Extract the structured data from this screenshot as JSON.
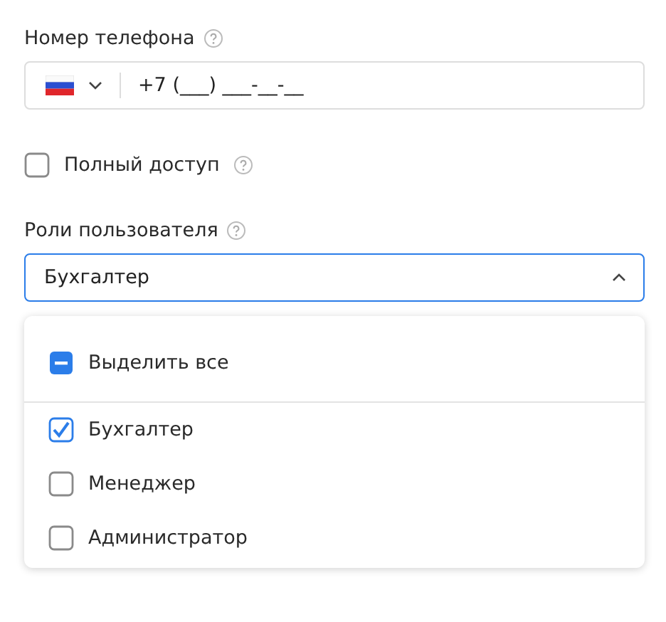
{
  "phone": {
    "label": "Номер телефона",
    "placeholder": "+7 (___) ___-__-__"
  },
  "full_access": {
    "label": "Полный доступ",
    "checked": false
  },
  "roles": {
    "label": "Роли пользователя",
    "value": "Бухгалтер",
    "expanded": true,
    "select_all": {
      "label": "Выделить все",
      "indeterminate": true
    },
    "options": [
      {
        "label": "Бухгалтер",
        "checked": true
      },
      {
        "label": "Менеджер",
        "checked": false
      },
      {
        "label": "Администратор",
        "checked": false
      }
    ]
  }
}
